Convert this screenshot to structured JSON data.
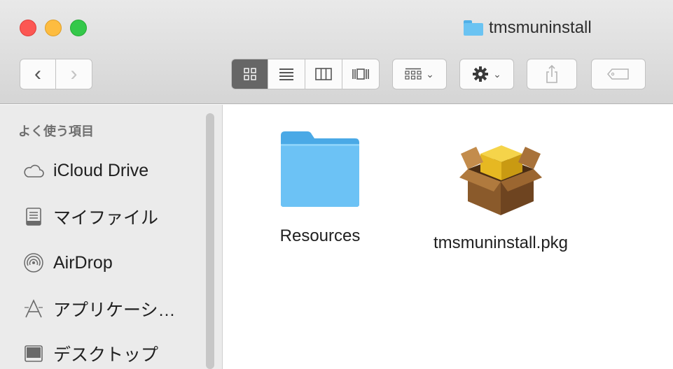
{
  "window": {
    "title": "tmsmuninstall",
    "traffic_colors": {
      "close": "#fc5753",
      "minimize": "#fdbc40",
      "zoom": "#34c84a"
    }
  },
  "toolbar": {
    "back_glyph": "‹",
    "forward_glyph": "›",
    "view_modes": [
      "icon-view",
      "list-view",
      "column-view",
      "cover-flow-view"
    ],
    "selected_view": "icon-view",
    "arrange_icon": "grid-arrange-icon",
    "action_icon": "gear-icon",
    "share_icon": "share-icon",
    "tag_icon": "tag-icon",
    "chevron": "⌄"
  },
  "sidebar": {
    "heading": "よく使う項目",
    "items": [
      {
        "label": "iCloud Drive",
        "icon": "cloud-icon"
      },
      {
        "label": "マイファイル",
        "icon": "all-my-files-icon"
      },
      {
        "label": "AirDrop",
        "icon": "airdrop-icon"
      },
      {
        "label": "アプリケーシ…",
        "icon": "applications-icon"
      },
      {
        "label": "デスクトップ",
        "icon": "desktop-icon"
      }
    ]
  },
  "files": [
    {
      "name": "Resources",
      "kind": "folder",
      "icon": "folder-icon",
      "color": "#5ab8f0"
    },
    {
      "name": "tmsmuninstall.pkg",
      "kind": "package",
      "icon": "package-icon"
    }
  ]
}
